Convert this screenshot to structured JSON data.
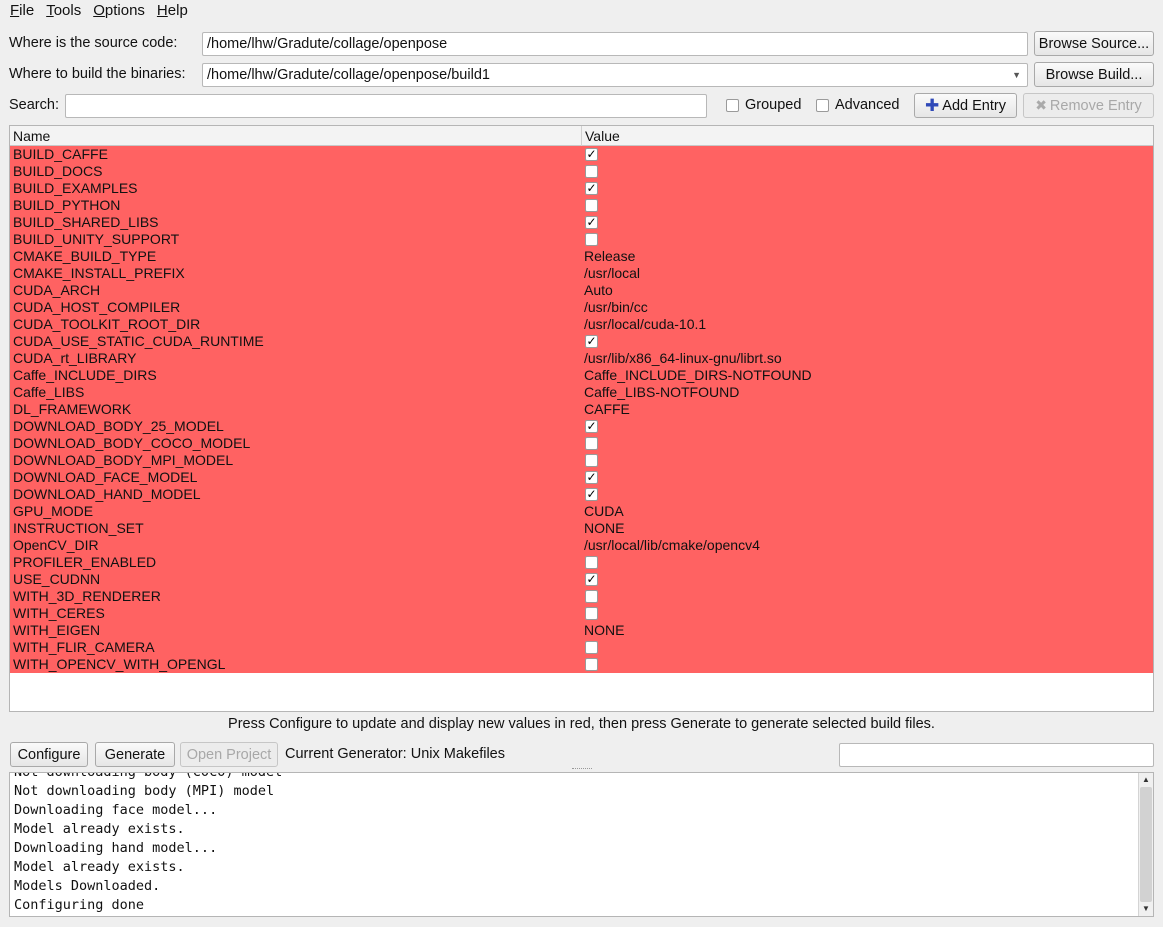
{
  "menu": {
    "items": [
      {
        "first": "F",
        "rest": "ile"
      },
      {
        "first": "T",
        "rest": "ools"
      },
      {
        "first": "O",
        "rest": "ptions"
      },
      {
        "first": "H",
        "rest": "elp"
      }
    ]
  },
  "source": {
    "label": "Where is the source code:",
    "value": "/home/lhw/Gradute/collage/openpose",
    "browse_label": "Browse Source..."
  },
  "build": {
    "label": "Where to build the binaries:",
    "value": "/home/lhw/Gradute/collage/openpose/build1",
    "browse_label": "Browse Build..."
  },
  "search": {
    "label": "Search:",
    "value": "",
    "grouped_label": "Grouped",
    "advanced_label": "Advanced",
    "add_entry_label": "Add Entry",
    "remove_entry_label": "Remove Entry"
  },
  "table": {
    "headers": [
      "Name",
      "Value"
    ],
    "row_color": "#ff6262",
    "rows": [
      {
        "name": "BUILD_CAFFE",
        "type": "bool",
        "checked": true,
        "value": ""
      },
      {
        "name": "BUILD_DOCS",
        "type": "bool",
        "checked": false,
        "value": ""
      },
      {
        "name": "BUILD_EXAMPLES",
        "type": "bool",
        "checked": true,
        "value": ""
      },
      {
        "name": "BUILD_PYTHON",
        "type": "bool",
        "checked": false,
        "value": ""
      },
      {
        "name": "BUILD_SHARED_LIBS",
        "type": "bool",
        "checked": true,
        "value": ""
      },
      {
        "name": "BUILD_UNITY_SUPPORT",
        "type": "bool",
        "checked": false,
        "value": ""
      },
      {
        "name": "CMAKE_BUILD_TYPE",
        "type": "text",
        "value": "Release"
      },
      {
        "name": "CMAKE_INSTALL_PREFIX",
        "type": "text",
        "value": "/usr/local"
      },
      {
        "name": "CUDA_ARCH",
        "type": "text",
        "value": "Auto"
      },
      {
        "name": "CUDA_HOST_COMPILER",
        "type": "text",
        "value": "/usr/bin/cc"
      },
      {
        "name": "CUDA_TOOLKIT_ROOT_DIR",
        "type": "text",
        "value": "/usr/local/cuda-10.1"
      },
      {
        "name": "CUDA_USE_STATIC_CUDA_RUNTIME",
        "type": "bool",
        "checked": true,
        "value": ""
      },
      {
        "name": "CUDA_rt_LIBRARY",
        "type": "text",
        "value": "/usr/lib/x86_64-linux-gnu/librt.so"
      },
      {
        "name": "Caffe_INCLUDE_DIRS",
        "type": "text",
        "value": "Caffe_INCLUDE_DIRS-NOTFOUND"
      },
      {
        "name": "Caffe_LIBS",
        "type": "text",
        "value": "Caffe_LIBS-NOTFOUND"
      },
      {
        "name": "DL_FRAMEWORK",
        "type": "text",
        "value": "CAFFE"
      },
      {
        "name": "DOWNLOAD_BODY_25_MODEL",
        "type": "bool",
        "checked": true,
        "value": ""
      },
      {
        "name": "DOWNLOAD_BODY_COCO_MODEL",
        "type": "bool",
        "checked": false,
        "value": ""
      },
      {
        "name": "DOWNLOAD_BODY_MPI_MODEL",
        "type": "bool",
        "checked": false,
        "value": ""
      },
      {
        "name": "DOWNLOAD_FACE_MODEL",
        "type": "bool",
        "checked": true,
        "value": ""
      },
      {
        "name": "DOWNLOAD_HAND_MODEL",
        "type": "bool",
        "checked": true,
        "value": ""
      },
      {
        "name": "GPU_MODE",
        "type": "text",
        "value": "CUDA"
      },
      {
        "name": "INSTRUCTION_SET",
        "type": "text",
        "value": "NONE"
      },
      {
        "name": "OpenCV_DIR",
        "type": "text",
        "value": "/usr/local/lib/cmake/opencv4"
      },
      {
        "name": "PROFILER_ENABLED",
        "type": "bool",
        "checked": false,
        "value": ""
      },
      {
        "name": "USE_CUDNN",
        "type": "bool",
        "checked": true,
        "value": ""
      },
      {
        "name": "WITH_3D_RENDERER",
        "type": "bool",
        "checked": false,
        "value": ""
      },
      {
        "name": "WITH_CERES",
        "type": "bool",
        "checked": false,
        "value": ""
      },
      {
        "name": "WITH_EIGEN",
        "type": "text",
        "value": "NONE"
      },
      {
        "name": "WITH_FLIR_CAMERA",
        "type": "bool",
        "checked": false,
        "value": ""
      },
      {
        "name": "WITH_OPENCV_WITH_OPENGL",
        "type": "bool",
        "checked": false,
        "value": ""
      }
    ]
  },
  "hint": "Press Configure to update and display new values in red, then press Generate to generate selected build files.",
  "actions": {
    "configure_label": "Configure",
    "generate_label": "Generate",
    "open_project_label": "Open Project",
    "generator_label": "Current Generator: Unix Makefiles",
    "filter_value": ""
  },
  "log": {
    "lines": [
      "Not downloading body (COCO) model",
      "Not downloading body (MPI) model",
      "Downloading face model...",
      "Model already exists.",
      "Downloading hand model...",
      "Model already exists.",
      "Models Downloaded.",
      "Configuring done"
    ]
  }
}
